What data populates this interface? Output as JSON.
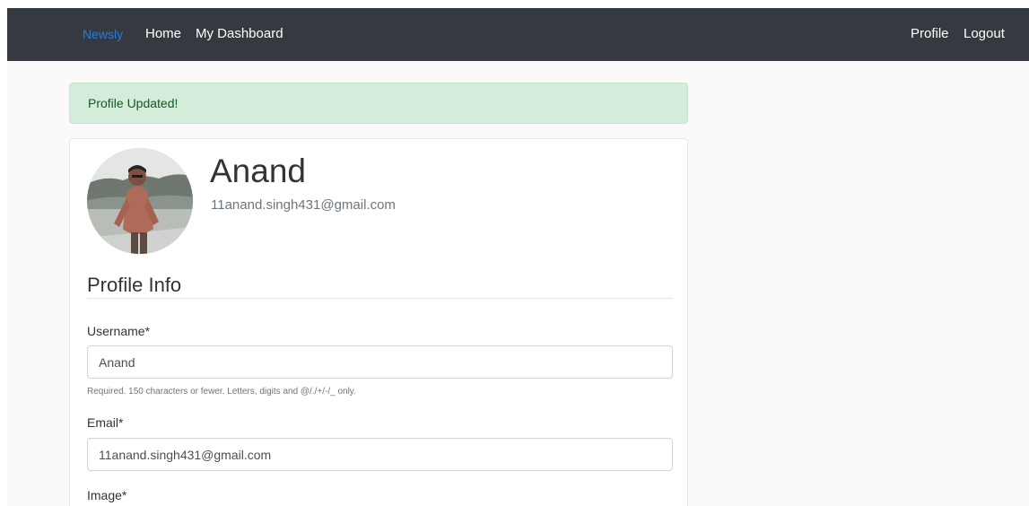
{
  "navbar": {
    "brand": "Newsly",
    "links": [
      "Home",
      "My Dashboard"
    ],
    "right_links": [
      "Profile",
      "Logout"
    ]
  },
  "alert": {
    "message": "Profile Updated!"
  },
  "profile": {
    "name": "Anand",
    "email": "11anand.singh431@gmail.com"
  },
  "form": {
    "section_title": "Profile Info",
    "username": {
      "label": "Username*",
      "value": "Anand",
      "help": "Required. 150 characters or fewer. Letters, digits and @/./+/-/_ only."
    },
    "email": {
      "label": "Email*",
      "value": "11anand.singh431@gmail.com"
    },
    "image": {
      "label": "Image*"
    }
  },
  "colors": {
    "navbar_bg": "#343a40",
    "brand": "#2a7bd8",
    "alert_bg": "#d4edda",
    "alert_text": "#155724"
  }
}
